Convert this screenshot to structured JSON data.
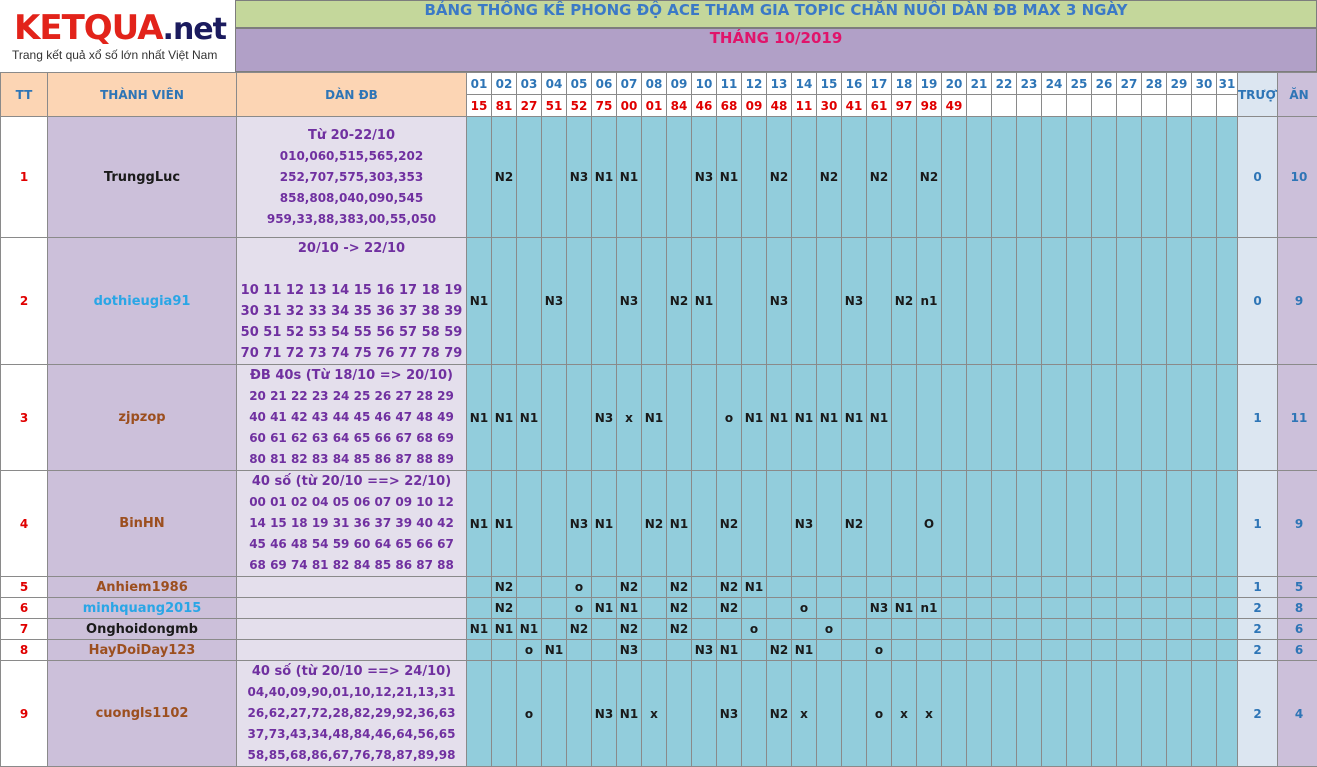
{
  "logo": {
    "brand": "KETQUA",
    "suffix": ".net",
    "tagline": "Trang kết quả xổ số lớn nhất Việt Nam"
  },
  "title": "BẢNG THỐNG KÊ PHONG ĐỘ ACE THAM GIA TOPIC CHĂN NUÔI DÀN ĐB MAX 3 NGÀY",
  "month": "THÁNG 10/2019",
  "headers": {
    "tt": "TT",
    "member": "THÀNH VIÊN",
    "dan": "DÀN ĐB",
    "truot": "TRƯỢT",
    "an": "ĂN"
  },
  "days": [
    "01",
    "02",
    "03",
    "04",
    "05",
    "06",
    "07",
    "08",
    "09",
    "10",
    "11",
    "12",
    "13",
    "14",
    "15",
    "16",
    "17",
    "18",
    "19",
    "20",
    "21",
    "22",
    "23",
    "24",
    "25",
    "26",
    "27",
    "28",
    "29",
    "30",
    "31"
  ],
  "results": [
    "15",
    "81",
    "27",
    "51",
    "52",
    "75",
    "00",
    "01",
    "84",
    "46",
    "68",
    "09",
    "48",
    "11",
    "30",
    "41",
    "61",
    "97",
    "98",
    "49",
    "",
    "",
    "",
    "",
    "",
    "",
    "",
    "",
    "",
    "",
    ""
  ],
  "colors": {
    "title_bg": "#c4d79b",
    "month_bg": "#b1a0c7",
    "cell_bg": "#92cddc",
    "member_bg": "#ccc0da",
    "dan_bg": "#e4dfec",
    "header_bg": "#fcd5b4"
  },
  "rows": [
    {
      "tt": "1",
      "member": "TrunggLuc",
      "color": "dark",
      "dan_title": "Từ 20-22/10",
      "dan_lines": [
        "010,060,515,565,202",
        "252,707,575,303,353",
        "858,808,040,090,545",
        "959,33,88,383,00,55,050"
      ],
      "marks": [
        "",
        "N2",
        "",
        "",
        "N3",
        "N1",
        "N1",
        "",
        "",
        "N3",
        "N1",
        "",
        "N2",
        "",
        "N2",
        "",
        "N2",
        "",
        "N2",
        "",
        "",
        "",
        "",
        "",
        "",
        "",
        "",
        "",
        "",
        "",
        ""
      ],
      "truot": "0",
      "an": "10"
    },
    {
      "tt": "2",
      "member": "dothieugia91",
      "color": "blue",
      "dan_title": "20/10 -> 22/10",
      "dan_lines": [
        "",
        "10 11 12 13 14 15 16 17 18 19",
        "30 31 32 33 34 35 36 37 38 39",
        "50 51 52 53 54 55 56 57 58 59",
        "70 71 72 73 74 75 76 77 78 79"
      ],
      "marks": [
        "N1",
        "",
        "",
        "N3",
        "",
        "",
        "N3",
        "",
        "N2",
        "N1",
        "",
        "",
        "N3",
        "",
        "",
        "N3",
        "",
        "N2",
        "n1",
        "",
        "",
        "",
        "",
        "",
        "",
        "",
        "",
        "",
        "",
        "",
        ""
      ],
      "truot": "0",
      "an": "9"
    },
    {
      "tt": "3",
      "member": "zjpzop",
      "color": "brown",
      "dan_title": "ĐB 40s (Từ 18/10 => 20/10)",
      "dan_lines": [
        "20 21 22 23 24 25 26 27 28 29",
        "40 41 42 43 44 45 46 47 48 49",
        "60 61 62 63 64 65 66 67 68 69",
        "80 81 82 83 84 85 86 87 88 89"
      ],
      "marks": [
        "N1",
        "N1",
        "N1",
        "",
        "",
        "N3",
        "x",
        "N1",
        "",
        "",
        "o",
        "N1",
        "N1",
        "N1",
        "N1",
        "N1",
        "N1",
        "",
        "",
        "",
        "",
        "",
        "",
        "",
        "",
        "",
        "",
        "",
        "",
        "",
        ""
      ],
      "truot": "1",
      "an": "11"
    },
    {
      "tt": "4",
      "member": "BinHN",
      "color": "brown",
      "dan_title": "40 số (từ 20/10 ==> 22/10)",
      "dan_lines": [
        "00 01 02 04 05 06 07 09 10 12",
        "14 15 18 19 31 36 37 39 40 42",
        "45 46 48 54 59 60 64 65 66 67",
        "68 69 74 81 82 84 85 86 87 88"
      ],
      "marks": [
        "N1",
        "N1",
        "",
        "",
        "N3",
        "N1",
        "",
        "N2",
        "N1",
        "",
        "N2",
        "",
        "",
        "N3",
        "",
        "N2",
        "",
        "",
        "O",
        "",
        "",
        "",
        "",
        "",
        "",
        "",
        "",
        "",
        "",
        "",
        ""
      ],
      "truot": "1",
      "an": "9"
    },
    {
      "tt": "5",
      "member": "Anhiem1986",
      "color": "brown",
      "dan_title": "",
      "dan_lines": [],
      "marks": [
        "",
        "N2",
        "",
        "",
        "o",
        "",
        "N2",
        "",
        "N2",
        "",
        "N2",
        "N1",
        "",
        "",
        "",
        "",
        "",
        "",
        "",
        "",
        "",
        "",
        "",
        "",
        "",
        "",
        "",
        "",
        "",
        "",
        ""
      ],
      "truot": "1",
      "an": "5"
    },
    {
      "tt": "6",
      "member": "minhquang2015",
      "color": "blue",
      "dan_title": "",
      "dan_lines": [],
      "marks": [
        "",
        "N2",
        "",
        "",
        "o",
        "N1",
        "N1",
        "",
        "N2",
        "",
        "N2",
        "",
        "",
        "o",
        "",
        "",
        "N3",
        "N1",
        "n1",
        "",
        "",
        "",
        "",
        "",
        "",
        "",
        "",
        "",
        "",
        "",
        ""
      ],
      "truot": "2",
      "an": "8"
    },
    {
      "tt": "7",
      "member": "Onghoidongmb",
      "color": "dark",
      "dan_title": "",
      "dan_lines": [],
      "marks": [
        "N1",
        "N1",
        "N1",
        "",
        "N2",
        "",
        "N2",
        "",
        "N2",
        "",
        "",
        "o",
        "",
        "",
        "o",
        "",
        "",
        "",
        "",
        "",
        "",
        "",
        "",
        "",
        "",
        "",
        "",
        "",
        "",
        "",
        ""
      ],
      "truot": "2",
      "an": "6"
    },
    {
      "tt": "8",
      "member": "HayDoiDay123",
      "color": "brown",
      "dan_title": "",
      "dan_lines": [],
      "marks": [
        "",
        "",
        "o",
        "N1",
        "",
        "",
        "N3",
        "",
        "",
        "N3",
        "N1",
        "",
        "N2",
        "N1",
        "",
        "",
        "o",
        "",
        "",
        "",
        "",
        "",
        "",
        "",
        "",
        "",
        "",
        "",
        "",
        "",
        ""
      ],
      "truot": "2",
      "an": "6"
    },
    {
      "tt": "9",
      "member": "cuongls1102",
      "color": "brown",
      "dan_title": "40 số (từ 20/10 ==> 24/10)",
      "dan_lines": [
        "04,40,09,90,01,10,12,21,13,31",
        "26,62,27,72,28,82,29,92,36,63",
        "37,73,43,34,48,84,46,64,56,65",
        "58,85,68,86,67,76,78,87,89,98"
      ],
      "marks": [
        "",
        "",
        "o",
        "",
        "",
        "N3",
        "N1",
        "x",
        "",
        "",
        "N3",
        "",
        "N2",
        "x",
        "",
        "",
        "o",
        "x",
        "x",
        "",
        "",
        "",
        "",
        "",
        "",
        "",
        "",
        "",
        "",
        "",
        ""
      ],
      "truot": "2",
      "an": "4"
    }
  ]
}
